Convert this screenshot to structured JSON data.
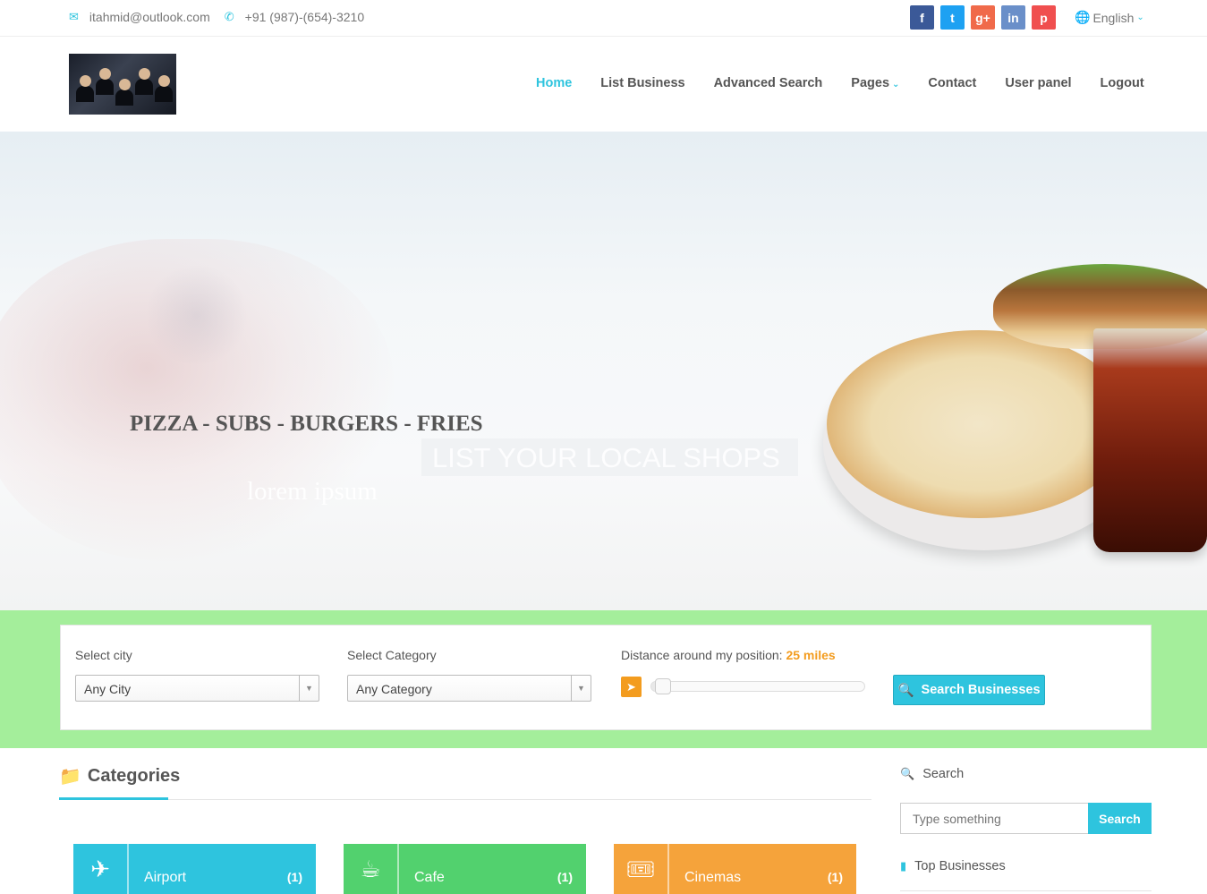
{
  "topbar": {
    "email": "itahmid@outlook.com",
    "phone": "+91 (987)-(654)-3210",
    "social": [
      {
        "icon": "facebook-icon",
        "glyph": "f",
        "color": "#3b5998"
      },
      {
        "icon": "twitter-icon",
        "glyph": "t",
        "color": "#1da1f2"
      },
      {
        "icon": "google-plus-icon",
        "glyph": "g+",
        "color": "#f06a4a"
      },
      {
        "icon": "linkedin-icon",
        "glyph": "in",
        "color": "#6a8fc9"
      },
      {
        "icon": "pinterest-icon",
        "glyph": "p",
        "color": "#f04f4f"
      }
    ],
    "language": "English"
  },
  "nav": {
    "items": [
      "Home",
      "List Business",
      "Advanced Search",
      "Pages",
      "Contact",
      "User panel",
      "Logout"
    ],
    "active": "Home"
  },
  "hero": {
    "title": "PIZZA - SUBS - BURGERS - FRIES",
    "banner": "LIST YOUR LOCAL SHOPS",
    "subtitle": "lorem ipsum"
  },
  "search_form": {
    "city_label": "Select city",
    "city_value": "Any City",
    "category_label": "Select Category",
    "category_value": "Any Category",
    "distance_label": "Distance around my position:",
    "distance_value": "25 miles",
    "distance_slider_fraction": 0.02,
    "button": "Search Businesses"
  },
  "categories": {
    "heading": "Categories",
    "items": [
      {
        "name": "Airport",
        "count": "(1)",
        "icon": "plane-icon",
        "glyph": "✈",
        "color": "#2ec4de"
      },
      {
        "name": "Cafe",
        "count": "(1)",
        "icon": "coffee-cup-icon",
        "glyph": "☕",
        "color": "#52d16e"
      },
      {
        "name": "Cinemas",
        "count": "(1)",
        "icon": "ticket-icon",
        "glyph": "🎟",
        "color": "#f5a33b"
      }
    ]
  },
  "sidebar": {
    "search_title": "Search",
    "search_placeholder": "Type something",
    "search_button": "Search",
    "top_title": "Top Businesses"
  },
  "colors": {
    "accent": "#2ec4de",
    "search_band": "#a4ee9b",
    "orange": "#f39c1f"
  }
}
